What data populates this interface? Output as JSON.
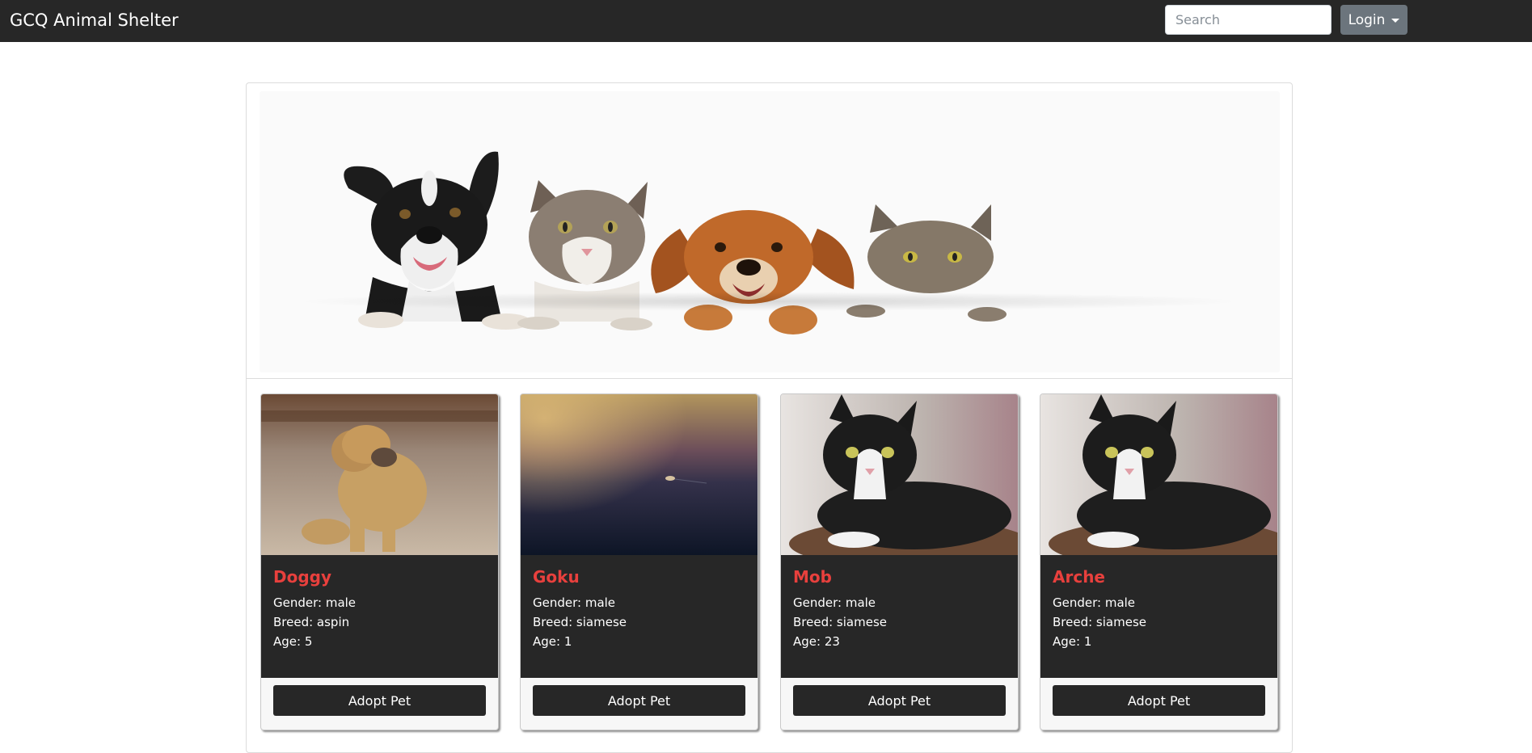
{
  "navbar": {
    "brand": "GCQ Animal Shelter",
    "search_placeholder": "Search",
    "search_value": "",
    "login_label": "Login"
  },
  "hero": {
    "image": "dogs-and-cats-peeking-banner"
  },
  "pets": [
    {
      "name": "Doggy",
      "gender": "Gender: male",
      "breed": "Breed: aspin",
      "age": "Age: 5",
      "image": "dog-photo",
      "button": "Adopt Pet"
    },
    {
      "name": "Goku",
      "gender": "Gender: male",
      "breed": "Breed: siamese",
      "age": "Age: 1",
      "image": "sunset-sea-photo",
      "button": "Adopt Pet"
    },
    {
      "name": "Mob",
      "gender": "Gender: male",
      "breed": "Breed: siamese",
      "age": "Age: 23",
      "image": "tuxedo-cat-photo",
      "button": "Adopt Pet"
    },
    {
      "name": "Arche",
      "gender": "Gender: male",
      "breed": "Breed: siamese",
      "age": "Age: 1",
      "image": "tuxedo-cat-photo",
      "button": "Adopt Pet"
    }
  ],
  "colors": {
    "navbar_bg": "#272727",
    "accent_name": "#e8403d",
    "card_body_bg": "#272727",
    "login_bg": "#6c757d"
  }
}
